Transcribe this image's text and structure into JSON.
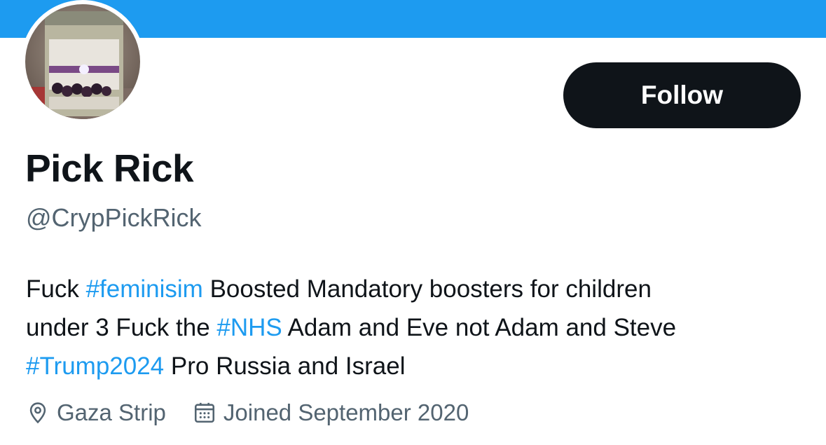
{
  "profile": {
    "avatar_icon": "profile-photo",
    "display_name": "Pick Rick",
    "handle": "@CrypPickRick",
    "follow_label": "Follow",
    "bio": {
      "line1": {
        "t1": "Fuck ",
        "h1": "#feminisim",
        "t2": " Boosted Mandatory boosters for children"
      },
      "line2": {
        "t1": "under 3 Fuck the ",
        "h1": "#NHS",
        "t2": " Adam and Eve not Adam and Steve"
      },
      "line3": {
        "h1": "#Trump2024",
        "t1": " Pro Russia and Israel"
      }
    },
    "location": "Gaza Strip",
    "location_icon": "location-pin-icon",
    "joined": "Joined September 2020",
    "joined_icon": "calendar-icon"
  },
  "colors": {
    "banner": "#1d9bf0",
    "hashtag": "#1d9bf0",
    "follow_button_bg": "#0f1419",
    "secondary_text": "#536471"
  }
}
